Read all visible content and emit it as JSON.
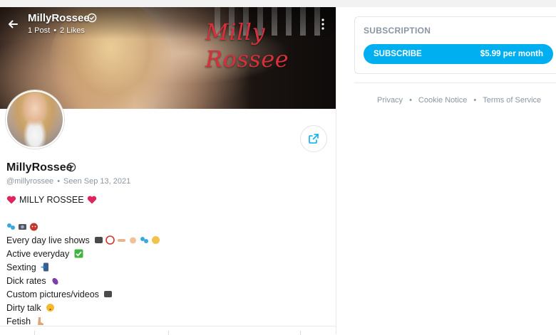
{
  "header": {
    "username": "MillyRossee",
    "posts": "1 Post",
    "likes": "2 Likes",
    "dot": "•",
    "cover_script_text": "Milly Rossee"
  },
  "profile": {
    "display_name": "MillyRossee",
    "handle": "@millyrossee",
    "seen": "Seen Sep 13, 2021",
    "dot": "•"
  },
  "bio": {
    "title": "MILLY ROSSEE",
    "lines": [
      "Every day live shows",
      "Active everyday",
      "Sexting",
      "Dick rates",
      "Custom pictures/videos",
      "Dirty talk",
      "Fetish"
    ]
  },
  "subscription": {
    "title": "SUBSCRIPTION",
    "button_label": "SUBSCRIBE",
    "price": "$5.99 per month"
  },
  "footer": {
    "links": [
      "Privacy",
      "Cookie Notice",
      "Terms of Service"
    ],
    "sep": "•"
  },
  "colors": {
    "accent": "#00aff0",
    "muted": "#8a96a3",
    "heart": "#e0245e",
    "script": "#d6303a"
  },
  "icons": {
    "back": "arrow-left-icon",
    "verified": "verified-check-icon",
    "more": "more-vertical-icon",
    "share": "share-icon"
  }
}
